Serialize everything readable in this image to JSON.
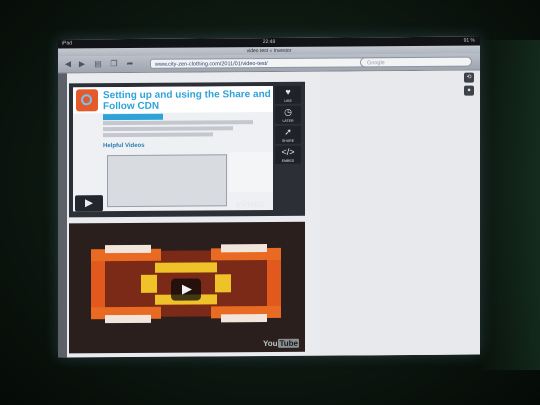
{
  "statusbar": {
    "carrier": "iPad",
    "time": "22:48",
    "battery": "91 %"
  },
  "window": {
    "title": "video test « Investor"
  },
  "toolbar": {
    "back_icon": "back-arrow-icon",
    "forward_icon": "forward-arrow-icon",
    "bookmarks_icon": "book-icon",
    "pages_icon": "pages-icon",
    "share_icon": "share-icon",
    "url": "www.city-zen-clothing.com/2011/01/video-test/",
    "search_placeholder": "Google"
  },
  "vimeo": {
    "title": "Setting up and using the Share and Follow CDN",
    "subheading": "Helpful Videos",
    "brand": "vimeo",
    "tools": [
      {
        "icon": "heart-icon",
        "label": "LIKE"
      },
      {
        "icon": "clock-icon",
        "label": "LATER"
      },
      {
        "icon": "share-icon",
        "label": "SHARE"
      },
      {
        "icon": "code-icon",
        "label": "EMBED"
      }
    ]
  },
  "youtube": {
    "logo_prefix": "You",
    "logo_suffix": "Tube"
  },
  "colors": {
    "vimeo_blue": "#2ea3d8",
    "youtube_orange": "#e1591c",
    "youtube_yellow": "#f0c22a"
  }
}
